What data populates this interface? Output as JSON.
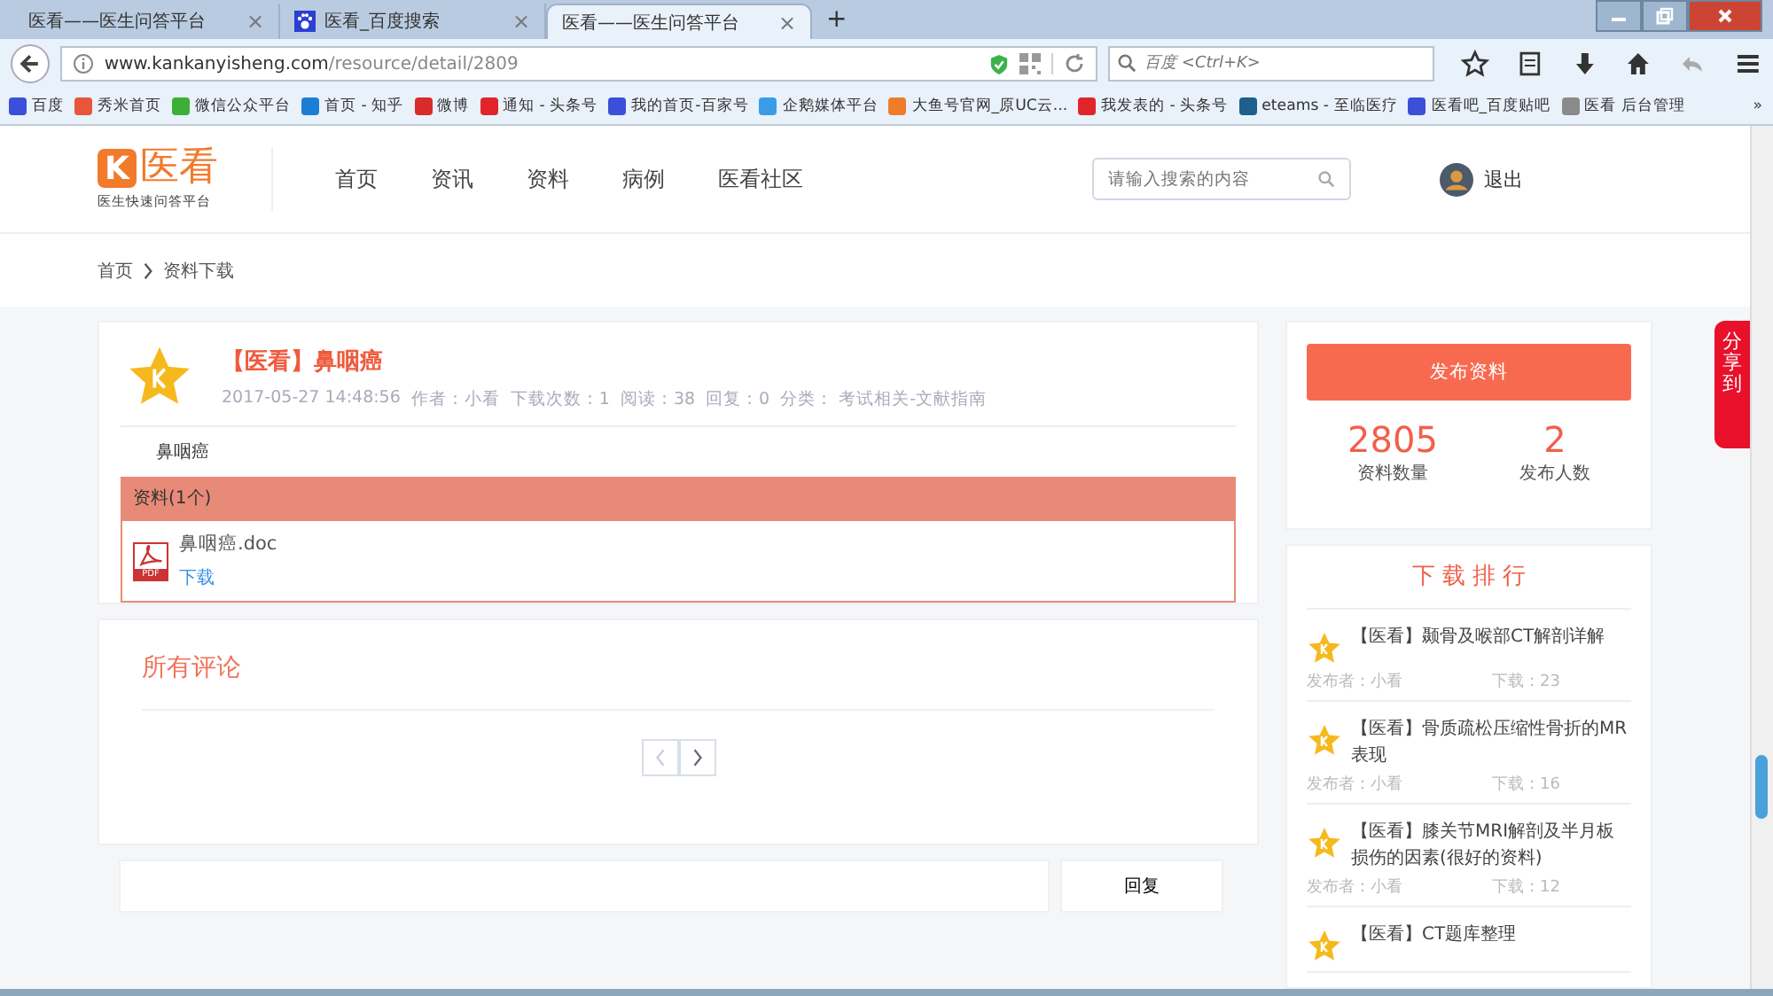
{
  "browser": {
    "tabs": [
      {
        "title": "医看——医生问答平台",
        "selected": false,
        "has_icon": false
      },
      {
        "title": "医看_百度搜索",
        "selected": false,
        "has_icon": true
      },
      {
        "title": "医看——医生问答平台",
        "selected": true,
        "has_icon": false
      }
    ],
    "new_tab": "+",
    "close_mark": "×",
    "url_host": "www.kankanyisheng.com",
    "url_path": "/resource/detail/2809",
    "search_placeholder": "百度 <Ctrl+K>",
    "bookmarks": [
      {
        "label": "百度",
        "color": "#3b4fd8"
      },
      {
        "label": "秀米首页",
        "color": "#e8553a"
      },
      {
        "label": "微信公众平台",
        "color": "#3cb034"
      },
      {
        "label": "首页 - 知乎",
        "color": "#1a7fd4"
      },
      {
        "label": "微博",
        "color": "#d92b2b"
      },
      {
        "label": "通知 - 头条号",
        "color": "#e0252a"
      },
      {
        "label": "我的首页-百家号",
        "color": "#3b4fd8"
      },
      {
        "label": "企鹅媒体平台",
        "color": "#3a9ce8"
      },
      {
        "label": "大鱼号官网_原UC云...",
        "color": "#f07c2a"
      },
      {
        "label": "我发表的 - 头条号",
        "color": "#e0252a"
      },
      {
        "label": "eteams - 至临医疗",
        "color": "#1e5f8c"
      },
      {
        "label": "医看吧_百度贴吧",
        "color": "#3b4fd8"
      },
      {
        "label": "医看 后台管理",
        "color": "#8a8a8a"
      }
    ],
    "bookmarks_more": "»"
  },
  "site": {
    "logo_letter": "K",
    "logo_text": "医看",
    "tagline": "医生快速问答平台",
    "nav": [
      {
        "label": "首页"
      },
      {
        "label": "资讯"
      },
      {
        "label": "资料"
      },
      {
        "label": "病例"
      },
      {
        "label": "医看社区"
      }
    ],
    "search_placeholder": "请输入搜索的内容",
    "logout": "退出"
  },
  "breadcrumb": [
    "首页",
    "资料下载"
  ],
  "article": {
    "title": "【医看】鼻咽癌",
    "date": "2017-05-27 14:48:56",
    "author": "作者：小看",
    "downloads": "下载次数：1",
    "reads": "阅读：38",
    "replies": "回复：0",
    "category": "分类： 考试相关-文献指南",
    "description": "鼻咽癌",
    "files_header": "资料(1个)",
    "file_name": "鼻咽癌.doc",
    "file_badge": "PDF",
    "download_link": "下载"
  },
  "comments": {
    "title": "所有评论",
    "prev_disabled": true,
    "next_disabled": false,
    "reply_button": "回复"
  },
  "sidebar": {
    "publish_button": "发布资料",
    "stats": [
      {
        "value": "2805",
        "label": "资料数量"
      },
      {
        "value": "2",
        "label": "发布人数"
      }
    ],
    "ranking_title": "下 载 排 行",
    "ranking": [
      {
        "title": "【医看】颞骨及喉部CT解剖详解",
        "publisher": "发布者：小看",
        "downloads": "下载：23"
      },
      {
        "title": "【医看】骨质疏松压缩性骨折的MR表现",
        "publisher": "发布者：小看",
        "downloads": "下载：16"
      },
      {
        "title": "【医看】膝关节MRI解剖及半月板损伤的因素(很好的资料)",
        "publisher": "发布者：小看",
        "downloads": "下载：12"
      },
      {
        "title": "【医看】CT题库整理"
      }
    ]
  },
  "share": "分享到"
}
